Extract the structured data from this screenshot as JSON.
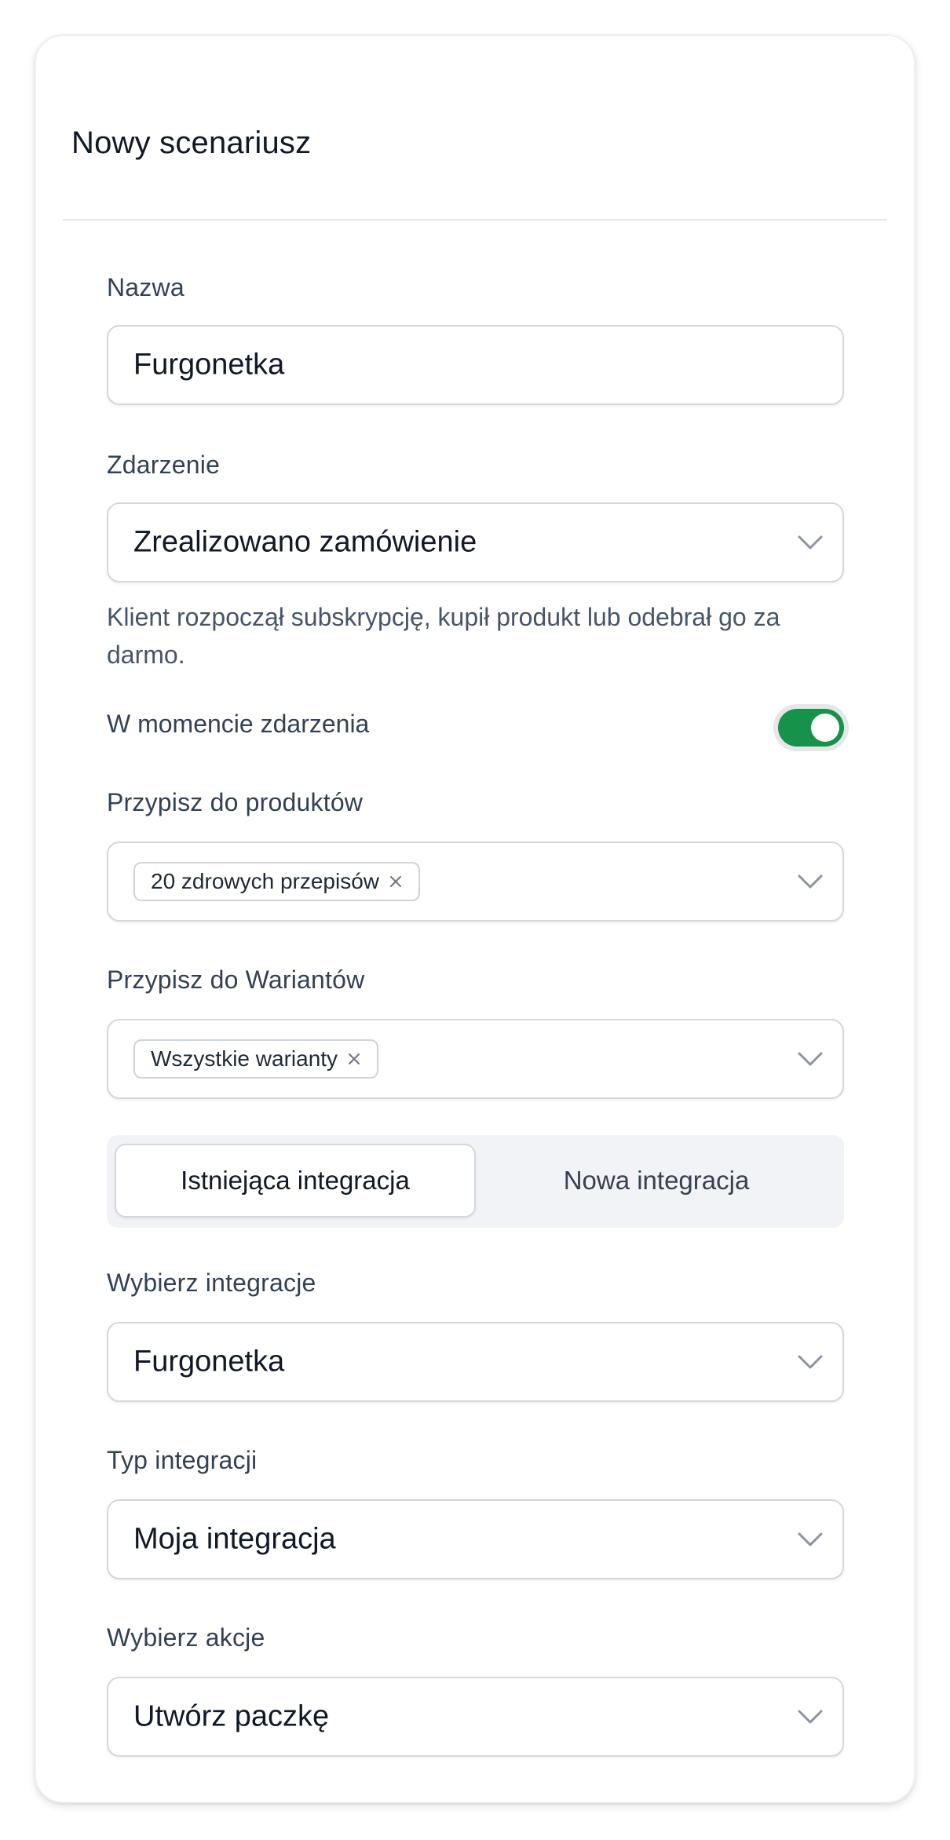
{
  "dialog": {
    "title": "Nowy scenariusz"
  },
  "name_field": {
    "label": "Nazwa",
    "value": "Furgonetka"
  },
  "event_field": {
    "label": "Zdarzenie",
    "value": "Zrealizowano zamówienie",
    "helper": "Klient rozpoczął subskrypcję, kupił produkt lub odebrał go za darmo."
  },
  "on_event_toggle": {
    "label": "W momencie zdarzenia",
    "checked": true,
    "on_color": "#16924a"
  },
  "products_field": {
    "label": "Przypisz do produktów",
    "tags": [
      "20 zdrowych przepisów"
    ]
  },
  "variants_field": {
    "label": "Przypisz do Wariantów",
    "tags": [
      "Wszystkie warianty"
    ]
  },
  "integration_tabs": {
    "options": [
      "Istniejąca integracja",
      "Nowa integracja"
    ],
    "selected": "Istniejąca integracja"
  },
  "integration_select": {
    "label": "Wybierz integracje",
    "value": "Furgonetka"
  },
  "integration_type": {
    "label": "Typ integracji",
    "value": "Moja integracja"
  },
  "action_select": {
    "label": "Wybierz akcje",
    "value": "Utwórz paczkę"
  },
  "icons": {
    "dropdown": "chevron-down-icon",
    "remove_tag": "close-icon"
  }
}
